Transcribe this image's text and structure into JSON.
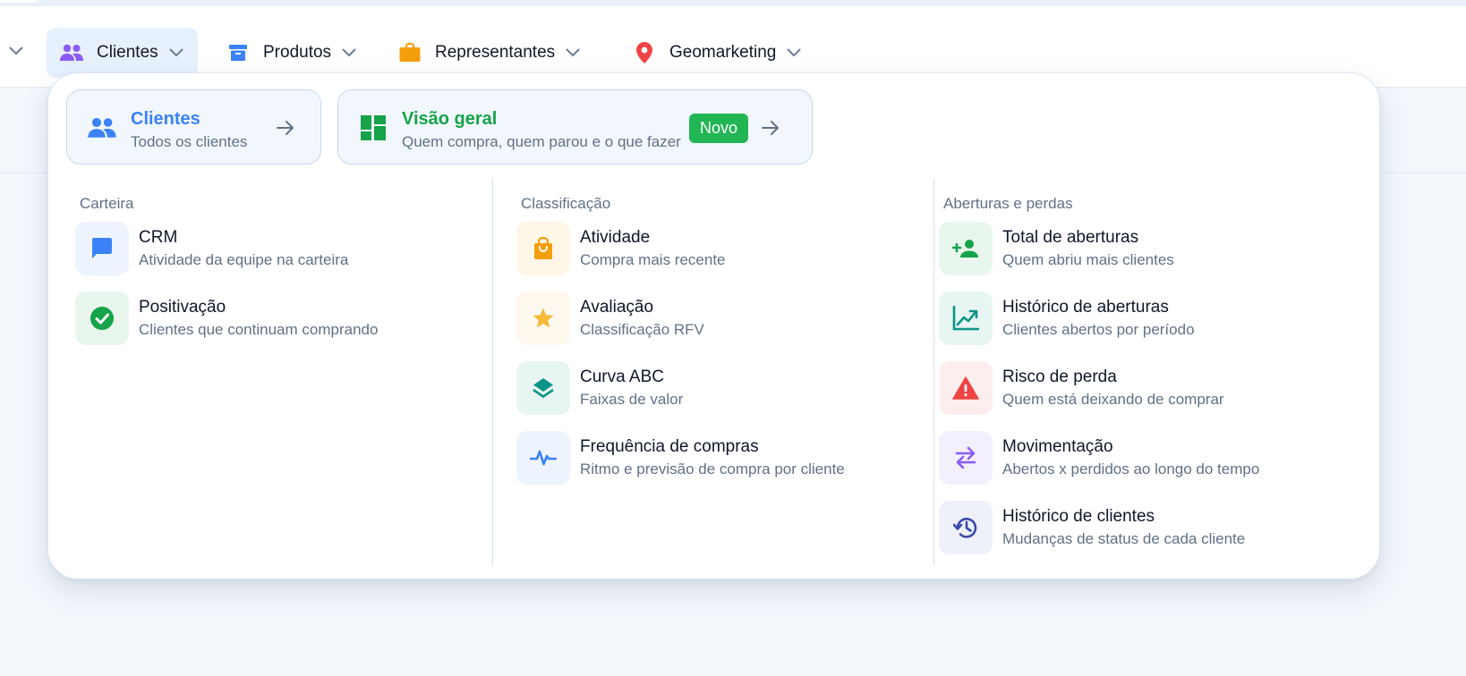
{
  "nav": {
    "items": [
      {
        "label": "Clientes",
        "icon": "people-icon"
      },
      {
        "label": "Produtos",
        "icon": "archive-box-icon"
      },
      {
        "label": "Representantes",
        "icon": "briefcase-icon"
      },
      {
        "label": "Geomarketing",
        "icon": "location-pin-icon"
      }
    ]
  },
  "menu": {
    "featured": [
      {
        "title": "Clientes",
        "subtitle": "Todos os clientes"
      },
      {
        "title": "Visão geral",
        "subtitle": "Quem compra, quem parou e o que fazer",
        "badge": "Novo"
      }
    ],
    "columns": [
      {
        "title": "Carteira",
        "items": [
          {
            "name": "CRM",
            "desc": "Atividade da equipe na carteira"
          },
          {
            "name": "Positivação",
            "desc": "Clientes que continuam comprando"
          }
        ]
      },
      {
        "title": "Classificação",
        "items": [
          {
            "name": "Atividade",
            "desc": "Compra mais recente"
          },
          {
            "name": "Avaliação",
            "desc": "Classificação RFV"
          },
          {
            "name": "Curva ABC",
            "desc": "Faixas de valor"
          },
          {
            "name": "Frequência de compras",
            "desc": "Ritmo e previsão de compra por cliente"
          }
        ]
      },
      {
        "title": "Aberturas e perdas",
        "items": [
          {
            "name": "Total de aberturas",
            "desc": "Quem abriu mais clientes"
          },
          {
            "name": "Histórico de aberturas",
            "desc": "Clientes abertos por período"
          },
          {
            "name": "Risco de perda",
            "desc": "Quem está deixando de comprar"
          },
          {
            "name": "Movimentação",
            "desc": "Abertos x perdidos ao longo do tempo"
          },
          {
            "name": "Histórico de clientes",
            "desc": "Mudanças de status de cada cliente"
          }
        ]
      }
    ]
  },
  "colors": {
    "accent_blue": "#3b82f6",
    "active_nav_bg": "#e7f0fd",
    "green": "#16a34a",
    "badge_green": "#22b554",
    "orange": "#f59e0b",
    "red": "#ef4444",
    "purple": "#8b5cf6",
    "teal": "#0d9488",
    "indigo": "#3949ab"
  }
}
